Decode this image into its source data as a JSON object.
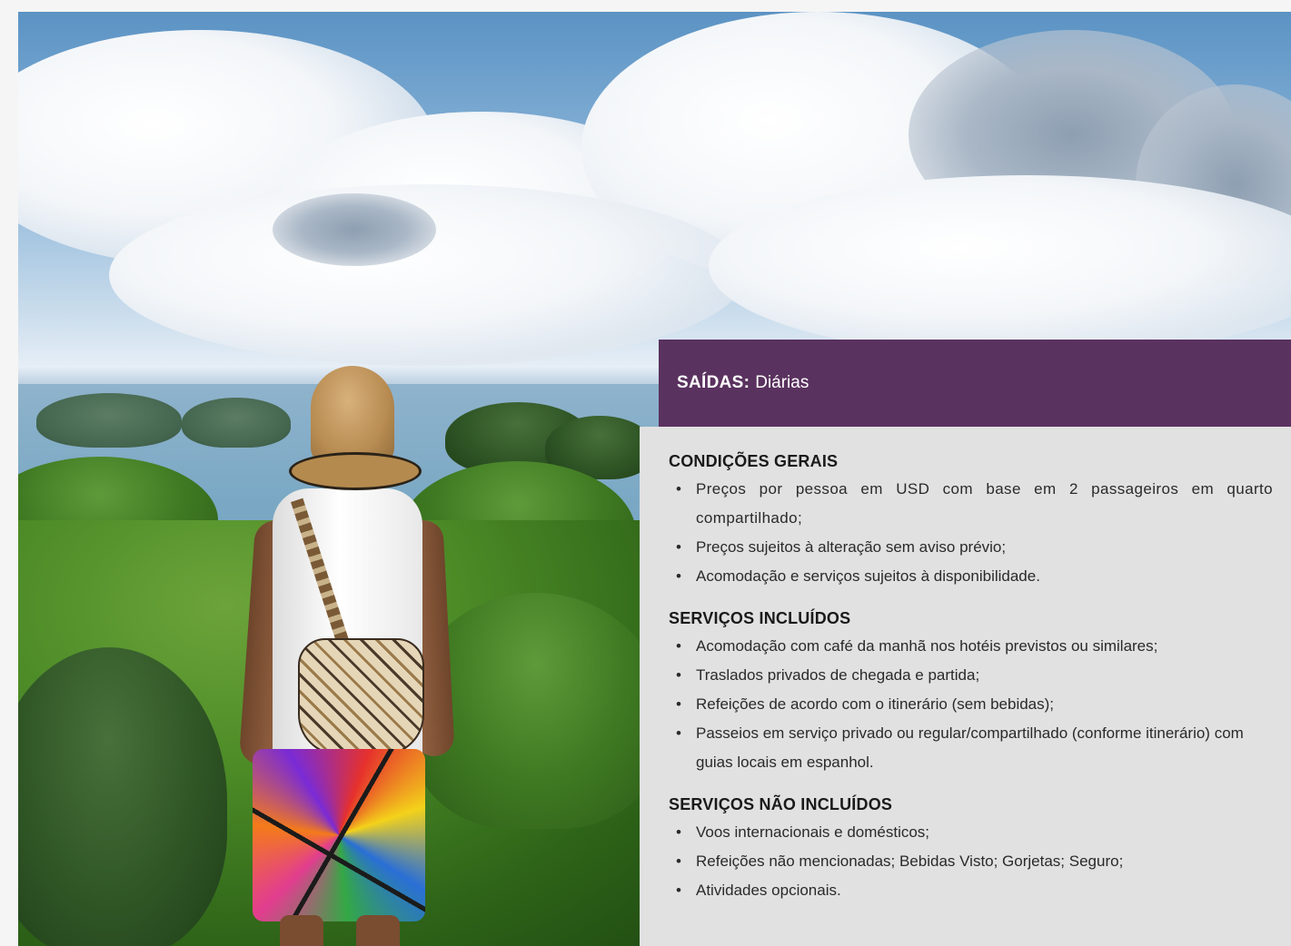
{
  "departures": {
    "label": "SAÍDAS:",
    "value": "Diárias"
  },
  "sections": [
    {
      "title": "CONDIÇÕES GERAIS",
      "items": [
        "Preços por pessoa em USD com base em 2 passageiros em quarto compartilhado;",
        "Preços sujeitos à alteração sem aviso prévio;",
        "Acomodação e serviços sujeitos à disponibilidade."
      ]
    },
    {
      "title": "SERVIÇOS INCLUÍDOS",
      "items": [
        "Acomodação com café da manhã nos hotéis previstos ou similares;",
        "Traslados privados de chegada e partida;",
        "Refeições de acordo com o itinerário (sem bebidas);",
        "Passeios em serviço privado ou regular/compartilhado (conforme itinerário) com guias locais em espanhol."
      ]
    },
    {
      "title": "SERVIÇOS NÃO INCLUÍDOS",
      "items": [
        "Voos internacionais e domésticos;",
        "Refeições não mencionadas; Bebidas Visto; Gorjetas; Seguro;",
        "Atividades opcionais."
      ]
    }
  ]
}
